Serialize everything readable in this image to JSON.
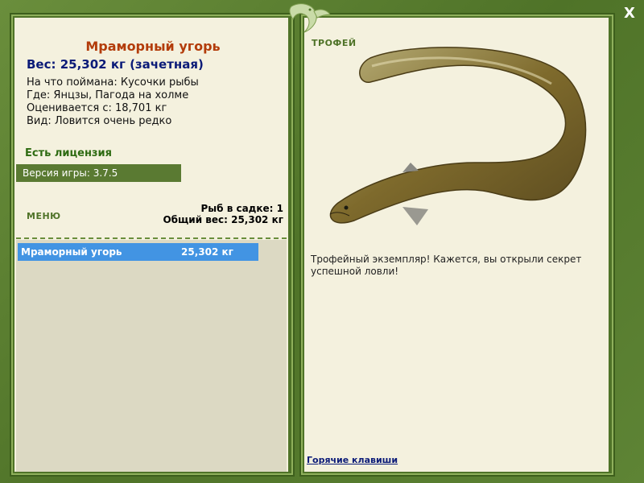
{
  "close_label": "X",
  "fish": {
    "name": "Мраморный угорь",
    "weight_line": "Вес: 25,302 кг (зачетная)",
    "caught_on": "На что поймана: Кусочки рыбы",
    "location": "Где: Янцзы, Пагода на холме",
    "valued_from": "Оценивается с: 18,701 кг",
    "rarity": "Вид: Ловится очень редко"
  },
  "license": "Есть лицензия",
  "version": "Версия игры: 3.7.5",
  "menu_label": "МЕНЮ",
  "counts": {
    "fish_in_net": "Рыб в садке: 1",
    "total_weight": "Общий вес: 25,302 кг"
  },
  "list": [
    {
      "name": "Мраморный угорь",
      "weight": "25,302 кг"
    }
  ],
  "trophy": {
    "title": "ТРОФЕЙ",
    "text": "Трофейный экземпляр! Кажется, вы открыли секрет успешной ловли!"
  },
  "hotkeys": "Горячие клавиши",
  "colors": {
    "frame": "#567a2e",
    "panel": "#f4f1de",
    "fish_name": "#b33c0a",
    "weight": "#0b1b78",
    "license": "#2e6b12",
    "selection": "#4294e3"
  }
}
